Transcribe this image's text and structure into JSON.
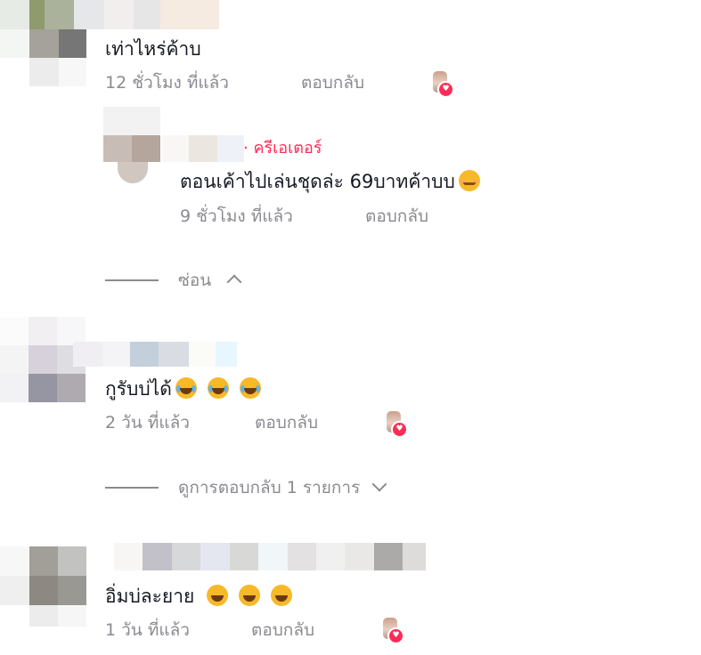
{
  "comments": [
    {
      "text": "เท่าไหร่ค้าบ",
      "time": "12 ชั่วโมง ที่แล้ว",
      "reply_label": "ตอบกลับ",
      "creator_liked": true
    },
    {
      "text": "กูรับบ่ได้",
      "emojis": [
        "joy-emoji",
        "joy-emoji",
        "joy-emoji"
      ],
      "time": "2 วัน ที่แล้ว",
      "reply_label": "ตอบกลับ",
      "creator_liked": true
    },
    {
      "text": "อิ่มบ่ละยาย",
      "emojis": [
        "rofl-emoji",
        "rofl-emoji",
        "rofl-emoji"
      ],
      "time": "1 วัน ที่แล้ว",
      "reply_label": "ตอบกลับ",
      "creator_liked": true
    }
  ],
  "reply": {
    "creator_badge": "· ครีเอเตอร์",
    "text": "ตอนเค้าไปเล่นชุดล่ะ 69บาทค้าบบ",
    "emoji": "smiling-emoji",
    "time": "9 ชั่วโมง ที่แล้ว",
    "reply_label": "ตอบกลับ"
  },
  "hide_replies_label": "ซ่อน",
  "view_replies_label": "ดูการตอบกลับ 1 รายการ",
  "colors": {
    "creator": "#fe2c55",
    "meta": "#8a8b91",
    "text": "#161823"
  }
}
